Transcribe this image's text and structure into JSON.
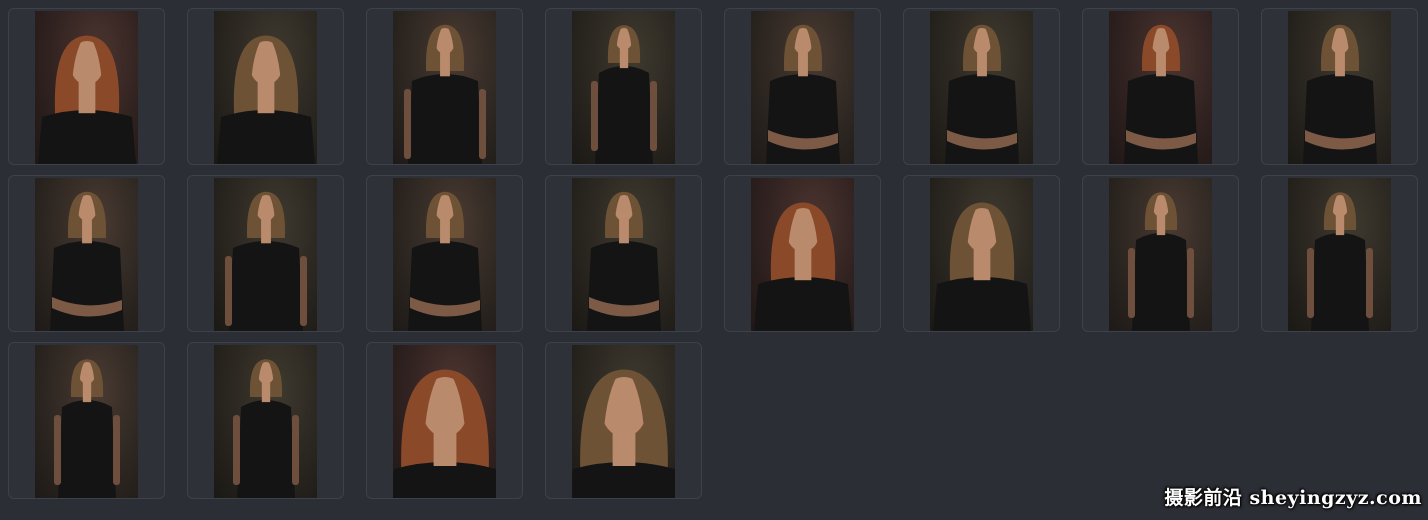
{
  "gallery": {
    "thumbnails": [
      {
        "shot": "closeup-bust",
        "palette": "warm"
      },
      {
        "shot": "closeup-bust",
        "palette": "neutral"
      },
      {
        "shot": "half-body",
        "palette": "neutral"
      },
      {
        "shot": "three-quarter",
        "palette": "neutral"
      },
      {
        "shot": "arms-crossed",
        "palette": "neutral"
      },
      {
        "shot": "arms-crossed",
        "palette": "neutral"
      },
      {
        "shot": "arms-crossed",
        "palette": "warm"
      },
      {
        "shot": "arms-crossed",
        "palette": "neutral"
      },
      {
        "shot": "arms-crossed",
        "palette": "neutral"
      },
      {
        "shot": "half-body",
        "palette": "neutral"
      },
      {
        "shot": "arms-crossed",
        "palette": "neutral"
      },
      {
        "shot": "arms-crossed",
        "palette": "neutral"
      },
      {
        "shot": "closeup-bust",
        "palette": "warm"
      },
      {
        "shot": "closeup-bust",
        "palette": "neutral"
      },
      {
        "shot": "three-quarter",
        "palette": "neutral"
      },
      {
        "shot": "three-quarter",
        "palette": "neutral"
      },
      {
        "shot": "three-quarter",
        "palette": "neutral"
      },
      {
        "shot": "three-quarter",
        "palette": "neutral"
      },
      {
        "shot": "closeup-face",
        "palette": "warm"
      },
      {
        "shot": "closeup-face",
        "palette": "neutral"
      }
    ]
  },
  "watermark": {
    "text": "摄影前沿 sheyingzyz.com"
  },
  "colors": {
    "background": "#2b2e34",
    "card_border": "#3d4149",
    "shirt": "#141414",
    "hair_warm": "#8a4a2a",
    "hair_neutral": "#6e5236",
    "skin": "#b98a6c"
  }
}
